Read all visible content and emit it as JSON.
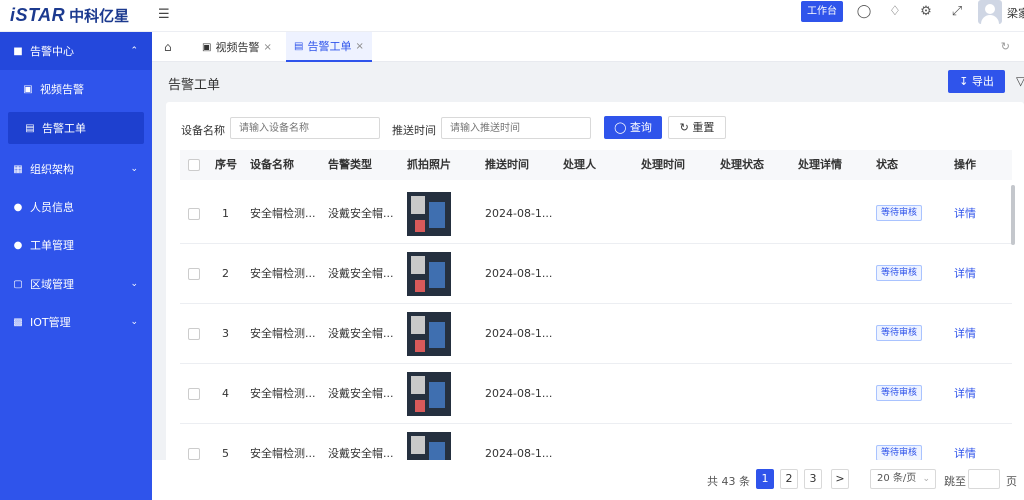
{
  "brand": {
    "logo_en": "iSTAR",
    "logo_cn": "中科亿星"
  },
  "header": {
    "workbench_label": "工作台",
    "username": "梁家",
    "icons": [
      "menu-fold-icon",
      "search-icon",
      "bell-icon",
      "gear-icon",
      "fullscreen-icon"
    ]
  },
  "sidebar": {
    "items": [
      {
        "label": "告警中心",
        "icon": "lock-icon",
        "expanded": true
      },
      {
        "label": "视频告警",
        "icon": "video-icon"
      },
      {
        "label": "告警工单",
        "icon": "document-icon",
        "active": true
      },
      {
        "label": "组织架构",
        "icon": "org-icon"
      },
      {
        "label": "人员信息",
        "icon": "user-icon"
      },
      {
        "label": "工单管理",
        "icon": "user-gear-icon"
      },
      {
        "label": "区域管理",
        "icon": "map-icon"
      },
      {
        "label": "IOT管理",
        "icon": "iot-icon"
      }
    ]
  },
  "tabs": [
    {
      "label": "视频告警",
      "active": false
    },
    {
      "label": "告警工单",
      "active": true
    }
  ],
  "page": {
    "title": "告警工单",
    "export_label": "导出"
  },
  "filters": {
    "device_label": "设备名称",
    "device_placeholder": "请输入设备名称",
    "time_label": "推送时间",
    "time_placeholder": "请输入推送时间",
    "query_label": "查询",
    "reset_label": "重置"
  },
  "table": {
    "columns": [
      "序号",
      "设备名称",
      "告警类型",
      "抓拍照片",
      "推送时间",
      "处理人",
      "处理时间",
      "处理状态",
      "处理详情",
      "状态",
      "操作"
    ],
    "rows": [
      {
        "index": "1",
        "device": "安全帽检测...",
        "type": "没戴安全帽...",
        "time": "2024-08-1...",
        "status": "等待审核",
        "action": "详情"
      },
      {
        "index": "2",
        "device": "安全帽检测...",
        "type": "没戴安全帽...",
        "time": "2024-08-1...",
        "status": "等待审核",
        "action": "详情"
      },
      {
        "index": "3",
        "device": "安全帽检测...",
        "type": "没戴安全帽...",
        "time": "2024-08-1...",
        "status": "等待审核",
        "action": "详情"
      },
      {
        "index": "4",
        "device": "安全帽检测...",
        "type": "没戴安全帽...",
        "time": "2024-08-1...",
        "status": "等待审核",
        "action": "详情"
      },
      {
        "index": "5",
        "device": "安全帽检测...",
        "type": "没戴安全帽...",
        "time": "2024-08-1...",
        "status": "等待审核",
        "action": "详情"
      }
    ]
  },
  "pagination": {
    "total_text": "共 43 条",
    "pages": [
      "1",
      "2",
      "3"
    ],
    "current": "1",
    "next_label": ">",
    "page_size": "20 条/页",
    "jump_label": "跳至",
    "page_suffix": "页"
  },
  "colors": {
    "primary": "#2f54eb",
    "sidebar": "#2f54eb",
    "background": "#f0f2f5"
  }
}
